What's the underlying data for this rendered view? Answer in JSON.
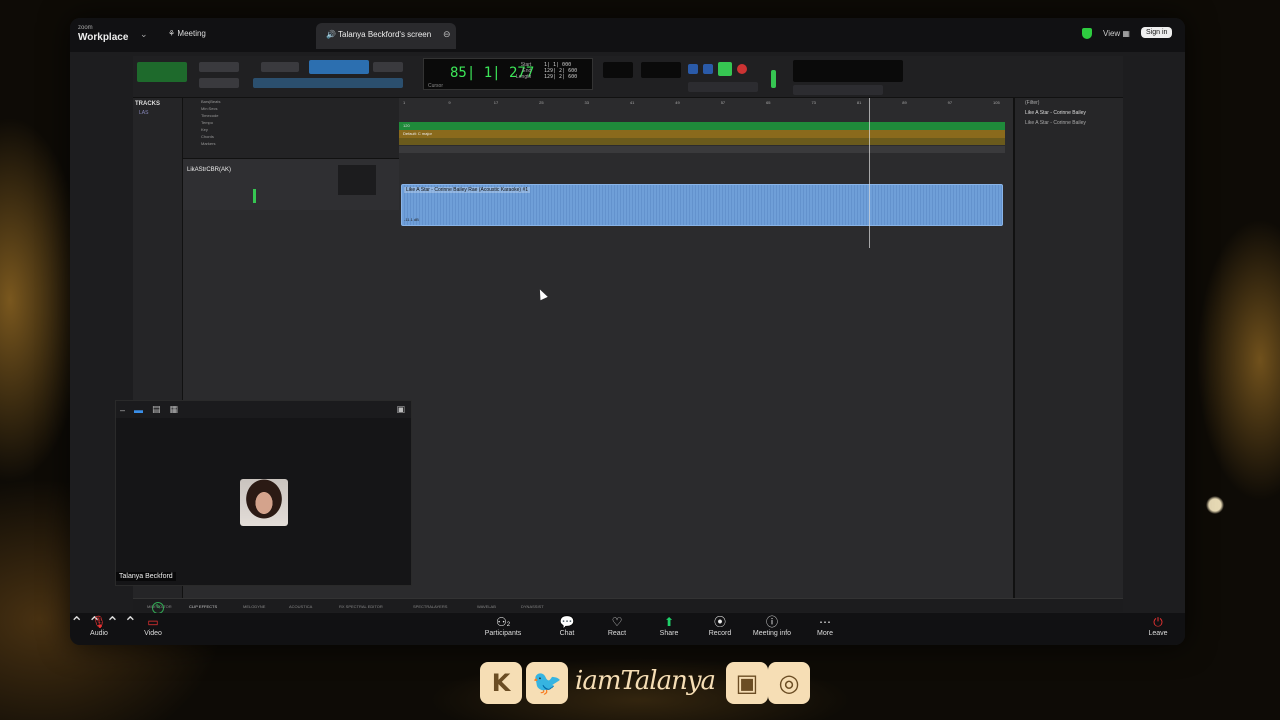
{
  "app": {
    "logo_small": "zoom",
    "logo_main": "Workplace",
    "meeting_tab": "Meeting",
    "share_tab": "Talanya Beckford's screen",
    "view_label": "View",
    "signin_label": "Sign in"
  },
  "daw": {
    "counter": "85| 1| 277",
    "counter_sub": "Cursor",
    "start_labels": [
      "Start",
      "End",
      "Length"
    ],
    "start_values": [
      "1| 1| 000",
      "129| 2| 600",
      "129| 2| 600"
    ],
    "tracks_header": "TRACKS",
    "track_item": "LAS",
    "ruler_rows": [
      "Bars|Beats",
      "Min:Secs",
      "Timecode",
      "Tempo",
      "Key",
      "Chords",
      "Markers"
    ],
    "track_name": "LikAStrCBR(AK)",
    "default_key": "Default: C major",
    "tempo_val": "120",
    "clip_label": "Like A Star - Corinne Bailey Rae (Acoustic Karaoke) #1",
    "clip_level": "-11.1 dB",
    "right_filter": "(Filter)",
    "right_items": [
      "Like A Star - Corinne Bailey",
      "Like A Star - Corinne Bailey"
    ],
    "bottom_tabs": [
      "MIDI EDITOR",
      "CLIP EFFECTS",
      "MELODYNE",
      "ACOUSTICA",
      "RX SPECTRAL EDITOR",
      "SPECTRALAYERS",
      "WAVELAB",
      "DYNASSIST"
    ],
    "bar_ticks": [
      "1",
      "9",
      "17",
      "25",
      "33",
      "41",
      "49",
      "57",
      "65",
      "73",
      "81",
      "89",
      "97",
      "105"
    ]
  },
  "video": {
    "participant_name": "Talanya Beckford"
  },
  "controls": {
    "audio": "Audio",
    "video": "Video",
    "participants": "Participants",
    "participants_count": "2",
    "chat": "Chat",
    "react": "React",
    "share": "Share",
    "record": "Record",
    "meeting_info": "Meeting info",
    "more": "More",
    "leave": "Leave"
  },
  "branding": {
    "handle": "iamTalanya"
  },
  "colors": {
    "accent_green": "#36c652",
    "clip_blue": "#6f9fd8",
    "share_green": "#1fd16a",
    "brand_cream": "#f6deb5"
  }
}
